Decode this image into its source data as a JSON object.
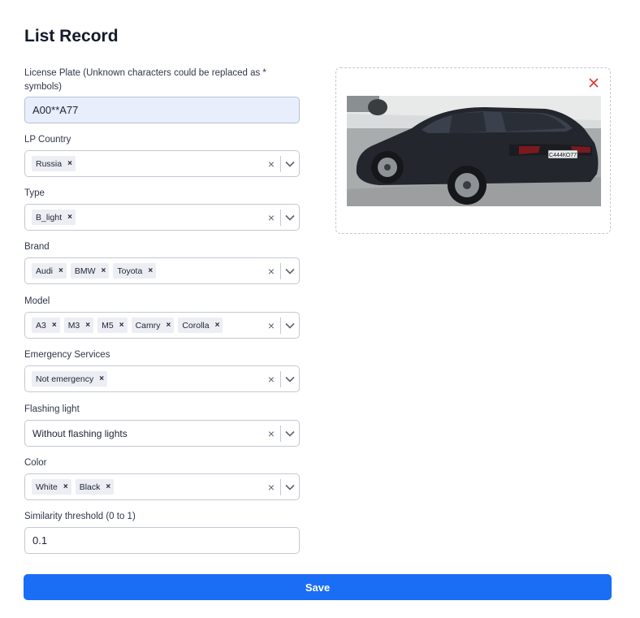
{
  "page": {
    "title": "List Record"
  },
  "license_plate": {
    "label": "License Plate (Unknown characters could be replaced as * symbols)",
    "value": "A00**A77"
  },
  "lp_country": {
    "label": "LP Country",
    "tags": [
      "Russia"
    ]
  },
  "type": {
    "label": "Type",
    "tags": [
      "B_light"
    ]
  },
  "brand": {
    "label": "Brand",
    "tags": [
      "Audi",
      "BMW",
      "Toyota"
    ]
  },
  "model": {
    "label": "Model",
    "tags": [
      "A3",
      "M3",
      "M5",
      "Camry",
      "Corolla"
    ]
  },
  "emergency": {
    "label": "Emergency Services",
    "tags": [
      "Not emergency"
    ]
  },
  "flashing": {
    "label": "Flashing light",
    "value": "Without flashing lights"
  },
  "color": {
    "label": "Color",
    "tags": [
      "White",
      "Black"
    ]
  },
  "similarity": {
    "label": "Similarity threshold (0 to 1)",
    "value": "0.1"
  },
  "image": {
    "plate_text": "С444КО77",
    "close_color": "#e0362c"
  },
  "save": {
    "label": "Save"
  },
  "icons": {
    "tag_remove": "×",
    "clear": "×"
  },
  "colors": {
    "accent": "#1a6df5",
    "close": "#e0362c"
  }
}
